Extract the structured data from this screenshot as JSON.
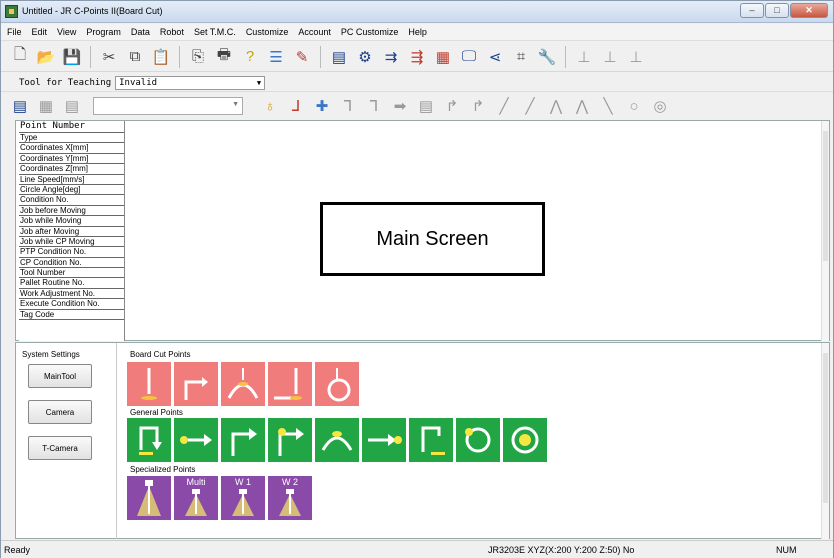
{
  "window": {
    "title": "Untitled - JR C-Points II(Board Cut)"
  },
  "menu": [
    "File",
    "Edit",
    "View",
    "Program",
    "Data",
    "Robot",
    "Set T.M.C.",
    "Customize",
    "Account",
    "PC Customize",
    "Help"
  ],
  "teaching": {
    "label": "Tool for Teaching",
    "value": "Invalid"
  },
  "point_table": {
    "header": "Point Number",
    "rows": [
      "Type",
      "Coordinates X[mm]",
      "Coordinates Y[mm]",
      "Coordinates Z[mm]",
      "Line Speed[mm/s]",
      "Circle Angle[deg]",
      "Condition No.",
      "Job before Moving",
      "Job while Moving",
      "Job after Moving",
      "Job while CP Moving",
      "PTP Condition No.",
      "CP Condition No.",
      "Tool Number",
      "Pallet Routine No.",
      "Work Adjustment No.",
      "Execute Condition No.",
      "Tag Code"
    ]
  },
  "main_label": "Main Screen",
  "system_settings": {
    "title": "System Settings",
    "buttons": [
      "MainTool",
      "Camera",
      "T-Camera"
    ]
  },
  "groups": {
    "board_cut": "Board Cut Points",
    "general": "General Points",
    "specialized": "Specialized Points"
  },
  "specialized_tiles": [
    "",
    "Multi",
    "W 1",
    "W 2"
  ],
  "status": {
    "left": "Ready",
    "middle": "JR3203E XYZ(X:200 Y:200 Z:50) No",
    "right": "NUM"
  },
  "colors": {
    "board_cut": "#f07c7c",
    "general": "#22a645",
    "specialized": "#8a4aa8"
  }
}
